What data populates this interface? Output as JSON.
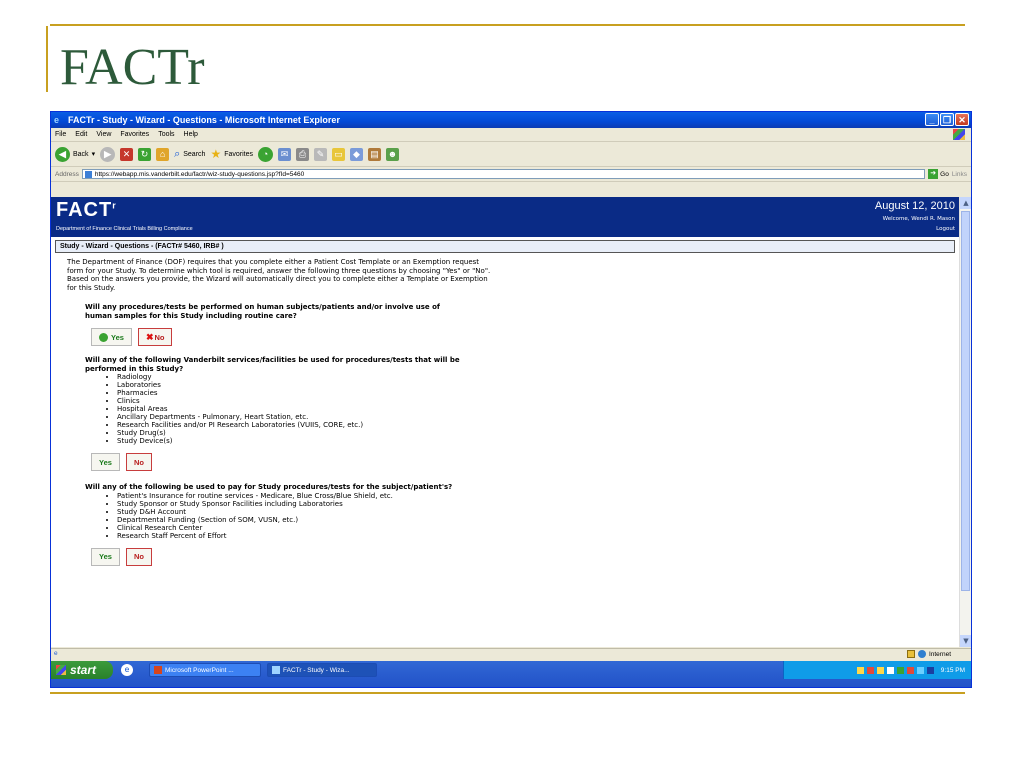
{
  "slide": {
    "title": "FACTr"
  },
  "window": {
    "title": "FACTr - Study - Wizard - Questions - Microsoft Internet Explorer",
    "controls": [
      "_",
      "❐",
      "✕"
    ]
  },
  "menu": [
    "File",
    "Edit",
    "View",
    "Favorites",
    "Tools",
    "Help"
  ],
  "toolbar": {
    "back": "Back",
    "search": "Search",
    "favorites": "Favorites"
  },
  "address": {
    "label": "Address",
    "url": "https://webapp.mis.vanderbilt.edu/factr/wiz-study-questions.jsp?fId=5460",
    "go": "Go",
    "links": "Links"
  },
  "header": {
    "logo": "FACT",
    "logo_sup": "r",
    "dept": "Department of Finance Clinical Trials Billing Compliance",
    "date": "August 12, 2010",
    "welcome": "Welcome, Wendi R. Mason",
    "logout": "Logout"
  },
  "breadcrumb": "Study - Wizard - Questions - (FACTr# 5460, IRB# )",
  "intro": "The Department of Finance (DOF) requires that you complete either a Patient Cost Template or an Exemption request form for your Study. To determine which tool is required, answer the following three questions by choosing \"Yes\" or \"No\". Based on the answers you provide, the Wizard will automatically direct you to complete either a Template or Exemption for this Study.",
  "questions": [
    {
      "text": "Will any procedures/tests be performed on human subjects/patients and/or involve use of human samples for this Study including routine care?",
      "items": [],
      "yes": "Yes",
      "no": "No"
    },
    {
      "text": "Will any of the following Vanderbilt services/facilities be used for procedures/tests that will be performed in this Study?",
      "items": [
        "Radiology",
        "Laboratories",
        "Pharmacies",
        "Clinics",
        "Hospital Areas",
        "Ancillary Departments - Pulmonary, Heart Station, etc.",
        "Research Facilities and/or PI Research Laboratories (VUIIS, CORE, etc.)",
        "Study Drug(s)",
        "Study Device(s)"
      ],
      "yes": "Yes",
      "no": "No"
    },
    {
      "text": "Will any of the following be used to pay for Study procedures/tests for the subject/patient's?",
      "items": [
        "Patient's Insurance for routine services - Medicare, Blue Cross/Blue Shield, etc.",
        "Study Sponsor or Study Sponsor Facilities including Laboratories",
        "Study D&H Account",
        "Departmental Funding (Section of SOM, VUSN, etc.)",
        "Clinical Research Center",
        "Research Staff Percent of Effort"
      ],
      "yes": "Yes",
      "no": "No"
    }
  ],
  "status": {
    "zone": "Internet"
  },
  "taskbar": {
    "start": "start",
    "tasks": [
      "Microsoft PowerPoint ...",
      "FACTr - Study - Wiza..."
    ],
    "clock": "9:15 PM"
  }
}
